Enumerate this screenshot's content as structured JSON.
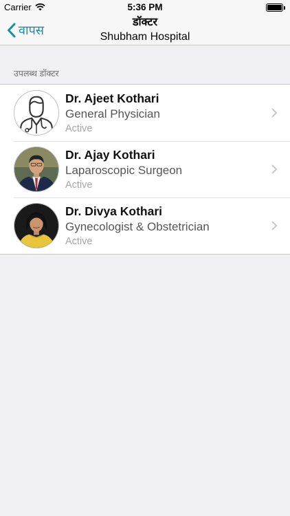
{
  "status_bar": {
    "carrier": "Carrier",
    "time": "5:36 PM"
  },
  "nav": {
    "back_label": "वापस",
    "title": "डॉक्टर",
    "subtitle": "Shubham Hospital"
  },
  "section_header": "उपलब्ध डॉक्टर",
  "doctors": [
    {
      "name": "Dr. Ajeet Kothari",
      "specialty": "General Physician",
      "status": "Active",
      "avatar_icon": "doctor-placeholder-icon"
    },
    {
      "name": "Dr. Ajay Kothari",
      "specialty": "Laparoscopic Surgeon",
      "status": "Active",
      "avatar_icon": "doctor-photo"
    },
    {
      "name": "Dr. Divya Kothari",
      "specialty": "Gynecologist & Obstetrician",
      "status": "Active",
      "avatar_icon": "doctor-photo"
    }
  ],
  "colors": {
    "accent": "#1a8fa3",
    "background": "#efeff4"
  }
}
